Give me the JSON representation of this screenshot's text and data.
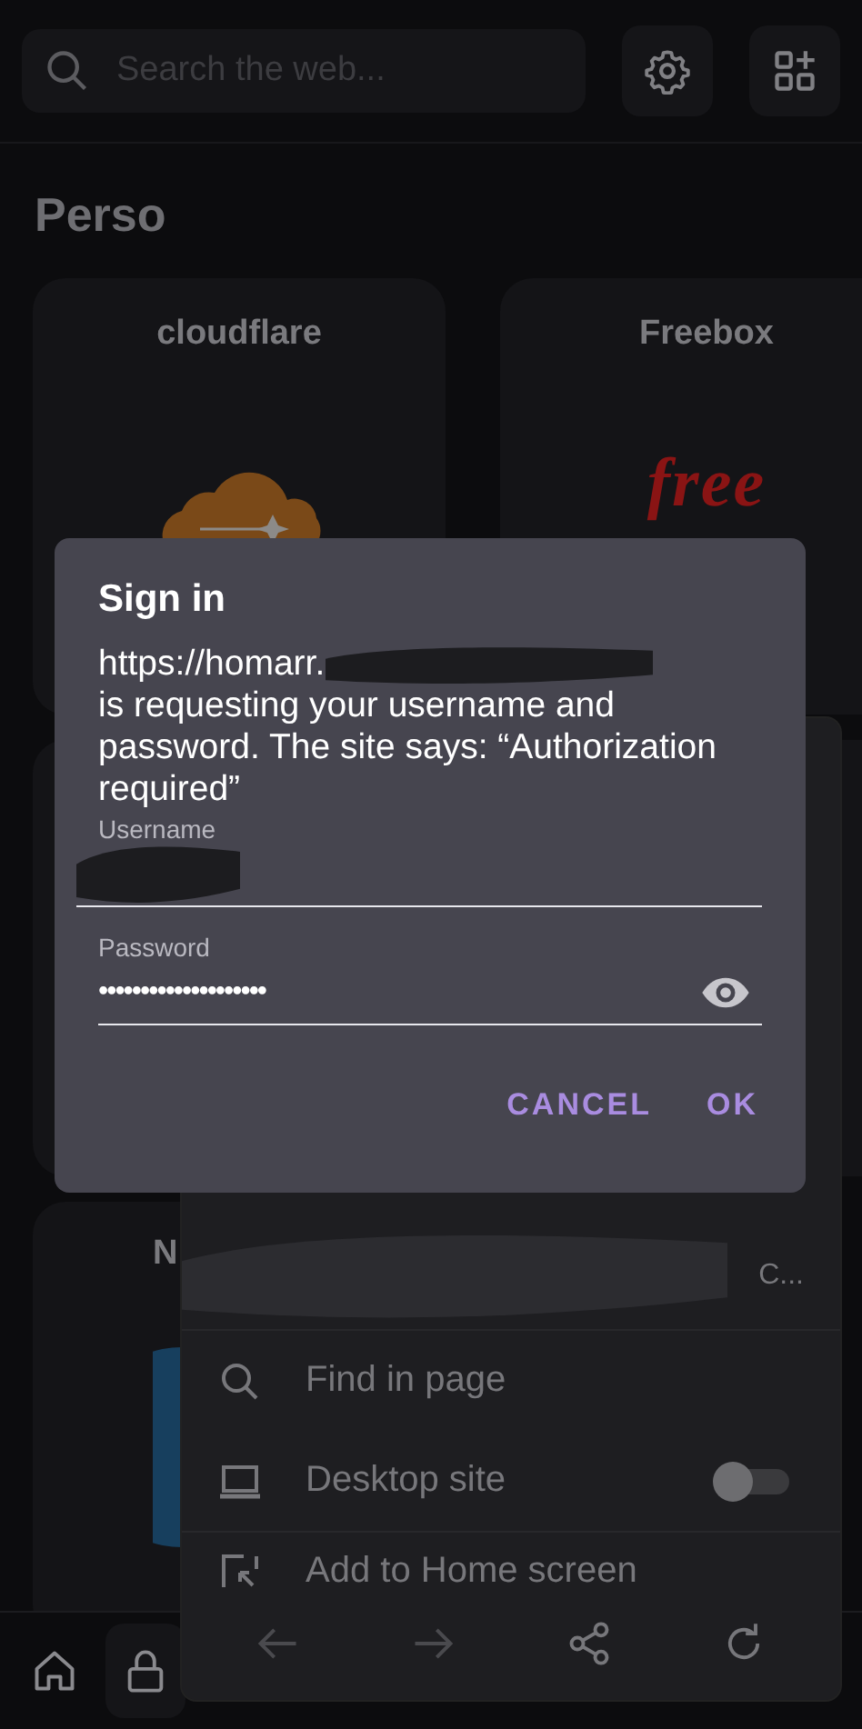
{
  "search": {
    "placeholder": "Search the web..."
  },
  "section_title": "Perso",
  "tiles": [
    {
      "kind": "cloudflare",
      "label": "cloudflare"
    },
    {
      "kind": "freebox",
      "label": "Freebox",
      "logo_text": "free"
    },
    {
      "kind": "blank"
    },
    {
      "kind": "blank"
    },
    {
      "kind": "circle",
      "label": "N"
    }
  ],
  "menu": {
    "items": [
      {
        "kind": "redacted",
        "label": "C..."
      },
      {
        "kind": "find",
        "label": "Find in page"
      },
      {
        "kind": "desktop",
        "label": "Desktop site",
        "toggle_on": false
      },
      {
        "kind": "add-home",
        "label": "Add to Home screen"
      }
    ]
  },
  "dialog": {
    "title": "Sign in",
    "url": "https://homarr.",
    "message": "is requesting your username and password. The site says: “Authorization required”",
    "username": {
      "label": "Username"
    },
    "password": {
      "label": "Password",
      "value": "••••••••••••••••••••"
    },
    "buttons": [
      "CANCEL",
      "OK"
    ]
  }
}
